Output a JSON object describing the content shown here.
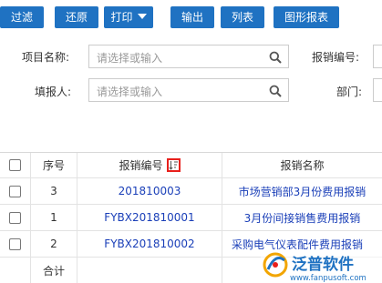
{
  "toolbar": {
    "filter": "过滤",
    "reset": "还原",
    "print": "打印",
    "export": "输出",
    "list": "列表",
    "chart_report": "图形报表"
  },
  "form": {
    "project_name_label": "项目名称:",
    "project_name_placeholder": "请选择或输入",
    "reimb_no_label": "报销编号:",
    "reporter_label": "填报人:",
    "reporter_placeholder": "请选择或输入",
    "dept_label": "部门:"
  },
  "table": {
    "headers": {
      "seq": "序号",
      "reimb_no": "报销编号",
      "reimb_name": "报销名称"
    },
    "rows": [
      {
        "seq": "3",
        "no": "201810003",
        "name": "市场营销部3月份费用报销"
      },
      {
        "seq": "1",
        "no": "FYBX201810001",
        "name": "3月份间接销售费用报销"
      },
      {
        "seq": "2",
        "no": "FYBX201810002",
        "name": "采购电气仪表配件费用报销"
      }
    ],
    "total_label": "合计"
  },
  "watermark": {
    "brand": "泛普软件",
    "url": "www.fanpusoft.com"
  },
  "colors": {
    "primary": "#1f72c2",
    "link": "#1a3fb8",
    "sort_highlight": "#e8201c"
  }
}
